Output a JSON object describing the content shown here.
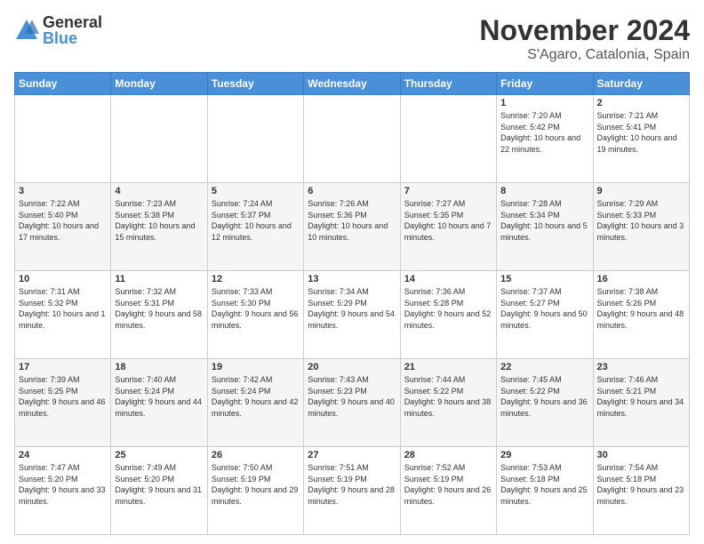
{
  "logo": {
    "general": "General",
    "blue": "Blue"
  },
  "title": "November 2024",
  "location": "S'Agaro, Catalonia, Spain",
  "days_of_week": [
    "Sunday",
    "Monday",
    "Tuesday",
    "Wednesday",
    "Thursday",
    "Friday",
    "Saturday"
  ],
  "weeks": [
    [
      {
        "day": "",
        "info": ""
      },
      {
        "day": "",
        "info": ""
      },
      {
        "day": "",
        "info": ""
      },
      {
        "day": "",
        "info": ""
      },
      {
        "day": "",
        "info": ""
      },
      {
        "day": "1",
        "info": "Sunrise: 7:20 AM\nSunset: 5:42 PM\nDaylight: 10 hours and 22 minutes."
      },
      {
        "day": "2",
        "info": "Sunrise: 7:21 AM\nSunset: 5:41 PM\nDaylight: 10 hours and 19 minutes."
      }
    ],
    [
      {
        "day": "3",
        "info": "Sunrise: 7:22 AM\nSunset: 5:40 PM\nDaylight: 10 hours and 17 minutes."
      },
      {
        "day": "4",
        "info": "Sunrise: 7:23 AM\nSunset: 5:38 PM\nDaylight: 10 hours and 15 minutes."
      },
      {
        "day": "5",
        "info": "Sunrise: 7:24 AM\nSunset: 5:37 PM\nDaylight: 10 hours and 12 minutes."
      },
      {
        "day": "6",
        "info": "Sunrise: 7:26 AM\nSunset: 5:36 PM\nDaylight: 10 hours and 10 minutes."
      },
      {
        "day": "7",
        "info": "Sunrise: 7:27 AM\nSunset: 5:35 PM\nDaylight: 10 hours and 7 minutes."
      },
      {
        "day": "8",
        "info": "Sunrise: 7:28 AM\nSunset: 5:34 PM\nDaylight: 10 hours and 5 minutes."
      },
      {
        "day": "9",
        "info": "Sunrise: 7:29 AM\nSunset: 5:33 PM\nDaylight: 10 hours and 3 minutes."
      }
    ],
    [
      {
        "day": "10",
        "info": "Sunrise: 7:31 AM\nSunset: 5:32 PM\nDaylight: 10 hours and 1 minute."
      },
      {
        "day": "11",
        "info": "Sunrise: 7:32 AM\nSunset: 5:31 PM\nDaylight: 9 hours and 58 minutes."
      },
      {
        "day": "12",
        "info": "Sunrise: 7:33 AM\nSunset: 5:30 PM\nDaylight: 9 hours and 56 minutes."
      },
      {
        "day": "13",
        "info": "Sunrise: 7:34 AM\nSunset: 5:29 PM\nDaylight: 9 hours and 54 minutes."
      },
      {
        "day": "14",
        "info": "Sunrise: 7:36 AM\nSunset: 5:28 PM\nDaylight: 9 hours and 52 minutes."
      },
      {
        "day": "15",
        "info": "Sunrise: 7:37 AM\nSunset: 5:27 PM\nDaylight: 9 hours and 50 minutes."
      },
      {
        "day": "16",
        "info": "Sunrise: 7:38 AM\nSunset: 5:26 PM\nDaylight: 9 hours and 48 minutes."
      }
    ],
    [
      {
        "day": "17",
        "info": "Sunrise: 7:39 AM\nSunset: 5:25 PM\nDaylight: 9 hours and 46 minutes."
      },
      {
        "day": "18",
        "info": "Sunrise: 7:40 AM\nSunset: 5:24 PM\nDaylight: 9 hours and 44 minutes."
      },
      {
        "day": "19",
        "info": "Sunrise: 7:42 AM\nSunset: 5:24 PM\nDaylight: 9 hours and 42 minutes."
      },
      {
        "day": "20",
        "info": "Sunrise: 7:43 AM\nSunset: 5:23 PM\nDaylight: 9 hours and 40 minutes."
      },
      {
        "day": "21",
        "info": "Sunrise: 7:44 AM\nSunset: 5:22 PM\nDaylight: 9 hours and 38 minutes."
      },
      {
        "day": "22",
        "info": "Sunrise: 7:45 AM\nSunset: 5:22 PM\nDaylight: 9 hours and 36 minutes."
      },
      {
        "day": "23",
        "info": "Sunrise: 7:46 AM\nSunset: 5:21 PM\nDaylight: 9 hours and 34 minutes."
      }
    ],
    [
      {
        "day": "24",
        "info": "Sunrise: 7:47 AM\nSunset: 5:20 PM\nDaylight: 9 hours and 33 minutes."
      },
      {
        "day": "25",
        "info": "Sunrise: 7:49 AM\nSunset: 5:20 PM\nDaylight: 9 hours and 31 minutes."
      },
      {
        "day": "26",
        "info": "Sunrise: 7:50 AM\nSunset: 5:19 PM\nDaylight: 9 hours and 29 minutes."
      },
      {
        "day": "27",
        "info": "Sunrise: 7:51 AM\nSunset: 5:19 PM\nDaylight: 9 hours and 28 minutes."
      },
      {
        "day": "28",
        "info": "Sunrise: 7:52 AM\nSunset: 5:19 PM\nDaylight: 9 hours and 26 minutes."
      },
      {
        "day": "29",
        "info": "Sunrise: 7:53 AM\nSunset: 5:18 PM\nDaylight: 9 hours and 25 minutes."
      },
      {
        "day": "30",
        "info": "Sunrise: 7:54 AM\nSunset: 5:18 PM\nDaylight: 9 hours and 23 minutes."
      }
    ]
  ]
}
